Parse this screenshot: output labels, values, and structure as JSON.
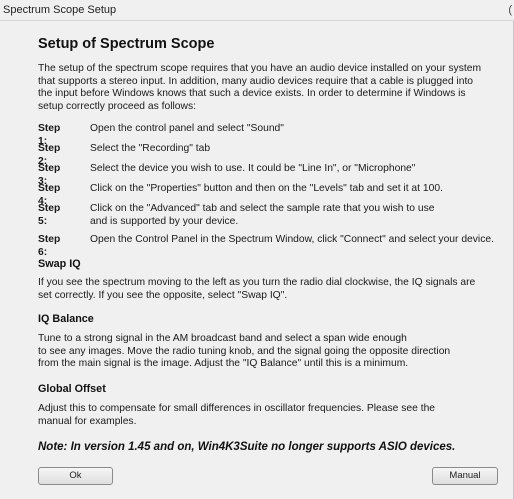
{
  "window": {
    "title": "Spectrum Scope Setup",
    "edge_char": "("
  },
  "heading": "Setup of Spectrum Scope",
  "intro": "The setup of the spectrum scope requires that you have an audio device installed on your system\nthat supports a stereo input.  In addition, many audio devices require that a cable is plugged into\nthe input before Windows knows that such a device exists.  In order to determine if Windows is\nsetup correctly proceed as follows:",
  "steps": [
    {
      "label": "Step 1:",
      "text": "Open the control panel and select \"Sound\""
    },
    {
      "label": "Step 2:",
      "text": "Select the \"Recording\" tab"
    },
    {
      "label": "Step 3:",
      "text": "Select the device you wish to use.  It could be \"Line In\", or \"Microphone\""
    },
    {
      "label": "Step 4:",
      "text": "Click on the \"Properties\" button and then on the \"Levels\" tab and set it at 100."
    },
    {
      "label": "Step 5:",
      "text": "Click on the \"Advanced\" tab and select the sample rate that you wish to use\nand is supported by your device."
    },
    {
      "label": "Step 6:",
      "text": "Open the Control Panel in the Spectrum Window, click \"Connect\" and select your device."
    }
  ],
  "swap_iq": {
    "title": "Swap IQ",
    "text": "If you see the spectrum moving to the left as you turn the radio dial clockwise, the IQ signals are\nset correctly.  If you see the opposite, select \"Swap IQ\"."
  },
  "iq_balance": {
    "title": "IQ Balance",
    "text": "Tune to a strong signal in the AM broadcast band and select a span wide enough\nto see any images.  Move the radio tuning knob, and the signal going the opposite direction\nfrom the main signal is the image.  Adjust the \"IQ Balance\" until this is a minimum."
  },
  "global_offset": {
    "title": "Global Offset",
    "text": "Adjust this to compensate for small differences in oscillator frequencies. Please see the\nmanual for examples."
  },
  "note": "Note: In version 1.45 and on, Win4K3Suite no longer supports ASIO devices.",
  "buttons": {
    "ok": "Ok",
    "manual": "Manual"
  }
}
